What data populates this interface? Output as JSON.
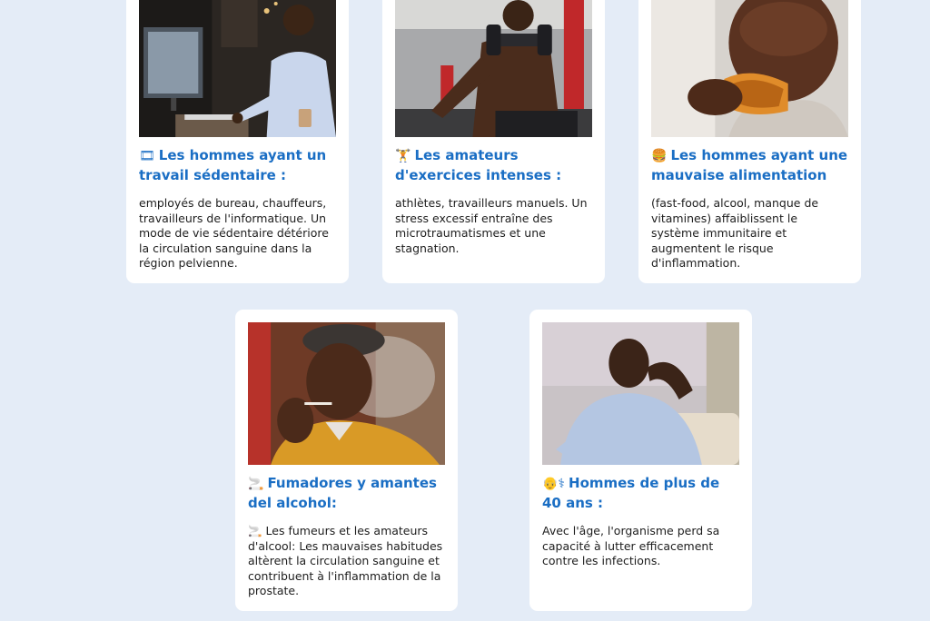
{
  "cards": [
    {
      "emoji": "🎞",
      "title": "Les hommes ayant un travail sédentaire :",
      "text": "employés de bureau, chauffeurs, travailleurs de l'informatique. Un mode de vie sédentaire détériore la circulation sanguine dans la région pelvienne.",
      "photo": "man-at-computer-photo"
    },
    {
      "emoji": "🏋",
      "title": "Les amateurs d'exercices intenses :",
      "text": "athlètes, travailleurs manuels. Un stress excessif entraîne des microtraumatismes et une stagnation.",
      "photo": "man-lifting-dumbbell-photo"
    },
    {
      "emoji": "🍔",
      "title": "Les hommes ayant une mauvaise alimentation",
      "text": "(fast-food, alcool, manque de vitamines) affaiblissent le système immunitaire et augmentent le risque d'inflammation.",
      "photo": "man-eating-fried-chicken-photo"
    },
    {
      "emoji": "🚬",
      "title": "Fumadores y amantes del alcohol:",
      "text": "🚬 Les fumeurs et les amateurs d'alcool: Les mauvaises habitudes altèrent la circulation sanguine et contribuent à l'inflammation de la prostate.",
      "photo": "man-smoking-photo"
    },
    {
      "emoji": "👴⚕",
      "title": "Hommes de plus de 40 ans :",
      "text": "Avec l'âge, l'organisme perd sa capacité à lutter efficacement contre les infections.",
      "photo": "tired-man-on-couch-photo"
    }
  ],
  "colors": {
    "background": "#e4ecf7",
    "card": "#ffffff",
    "title": "#1a6ec4",
    "text": "#1d1d1d"
  }
}
